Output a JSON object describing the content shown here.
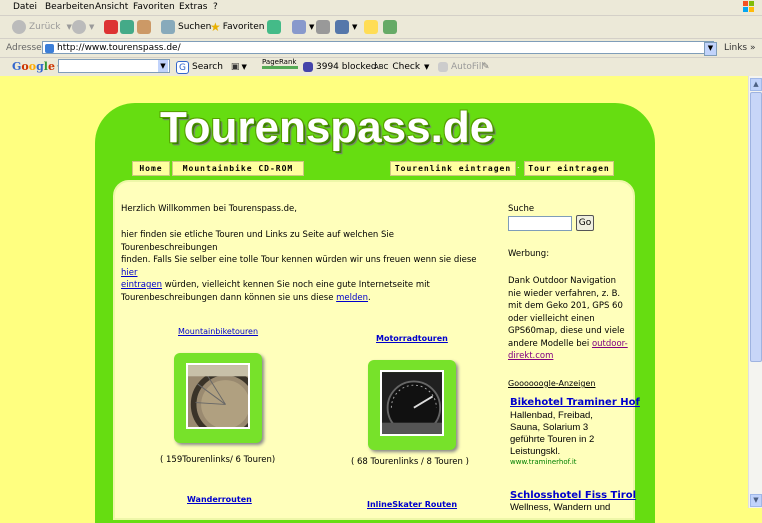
{
  "browser": {
    "menu": [
      "Datei",
      "Bearbeiten",
      "Ansicht",
      "Favoriten",
      "Extras",
      "?"
    ],
    "toolbar": {
      "back": "Zurück",
      "search": "Suchen",
      "favorites": "Favoriten"
    },
    "address_label": "Adresse",
    "url": "http://www.tourenspass.de/",
    "links_label": "Links",
    "google": {
      "logo": "Google",
      "search": "Search",
      "pagerank": "PageRank",
      "blocked": "3994 blocked",
      "check": "Check",
      "autofill": "AutoFill"
    }
  },
  "site": {
    "logo": "Tourenspass.de",
    "nav": [
      "Home",
      "Mountainbike CD-ROM",
      "Tourenlink eintragen",
      "Tour eintragen"
    ],
    "nav_sep": ".",
    "welcome": "Herzlich Willkommen bei Tourenspass.de,",
    "intro_1": "hier finden sie etliche Touren und Links zu Seite auf welchen Sie Tourenbeschreibungen",
    "intro_2": "finden. Falls Sie selber eine tolle Tour kennen würden wir uns freuen wenn sie diese",
    "intro_link1": "hier",
    "intro_link1b": "eintragen",
    "intro_3": "würden, vielleicht kennen Sie noch eine gute Internetseite mit",
    "intro_4": "Tourenbeschreibungen dann können sie uns diese",
    "intro_link2": "melden",
    "intro_end": ".",
    "categories": [
      {
        "label": "Mountainbiketouren",
        "count": "( 159Tourenlinks/ 6 Touren)"
      },
      {
        "label": "Motorradtouren",
        "count": "( 68 Tourenlinks / 8 Touren )"
      },
      {
        "label": "Wanderrouten"
      },
      {
        "label": "InlineSkater Routen"
      }
    ],
    "sidebar": {
      "search_label": "Suche",
      "go": "Go",
      "werbung": "Werbung:",
      "ad_lines": [
        "Dank Outdoor Navigation",
        "nie wieder verfahren, z. B.",
        "mit dem Geko 201, GPS 60",
        "oder vielleicht einen",
        "GPS60map, diese und viele",
        "andere Modelle bei"
      ],
      "ad_link_a": "outdoor-",
      "ad_link_b": "direkt.com",
      "google_ads": "Goooooogle-Anzeigen",
      "ads": [
        {
          "title": "Bikehotel Traminer Hof",
          "lines": [
            "Hallenbad, Freibad,",
            "Sauna, Solarium 3",
            "geführte Touren in 2",
            "Leistungskl."
          ],
          "url": "www.traminerhof.it"
        },
        {
          "title": "Schlosshotel Fiss Tirol",
          "lines": [
            "Wellness, Wandern und"
          ]
        }
      ]
    }
  }
}
